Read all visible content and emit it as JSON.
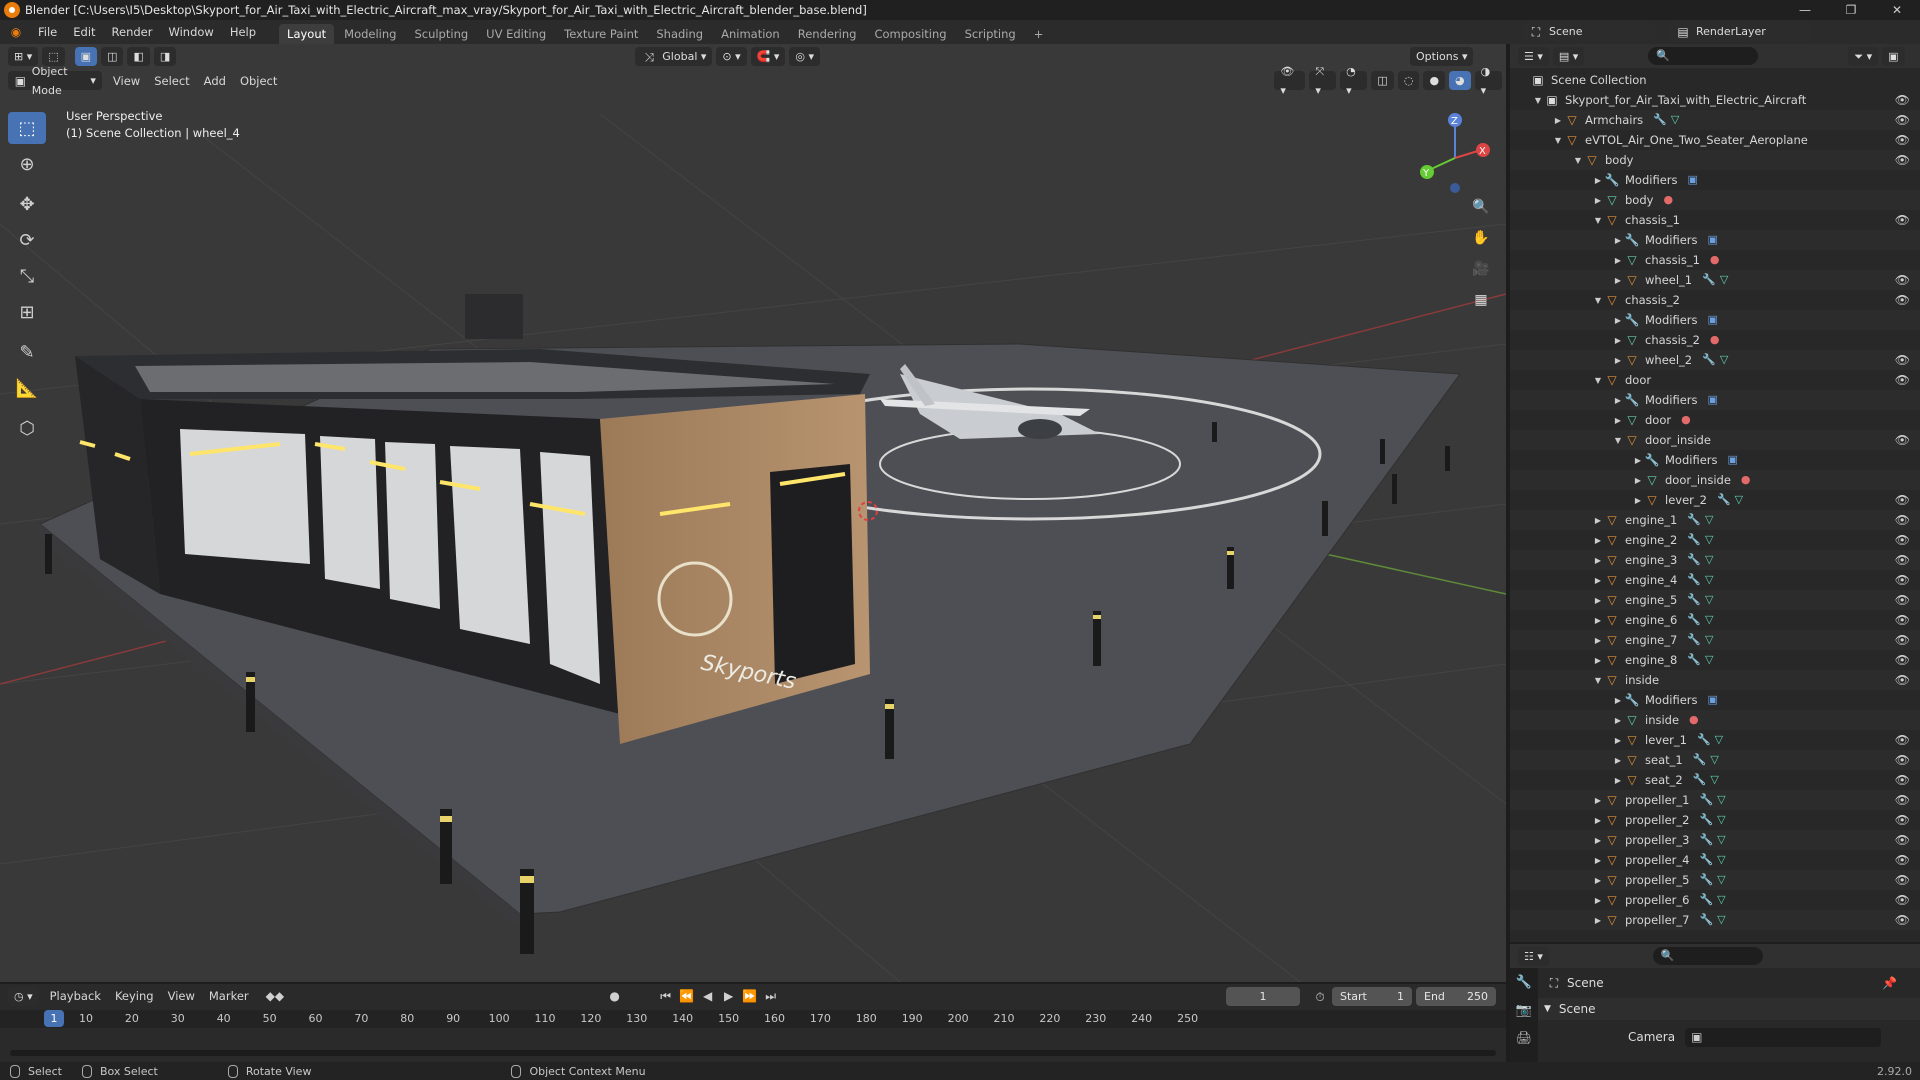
{
  "window": {
    "title": "Blender [C:\\Users\\I5\\Desktop\\Skyport_for_Air_Taxi_with_Electric_Aircraft_max_vray/Skyport_for_Air_Taxi_with_Electric_Aircraft_blender_base.blend]"
  },
  "menu": [
    "File",
    "Edit",
    "Render",
    "Window",
    "Help"
  ],
  "workspaces": [
    "Layout",
    "Modeling",
    "Sculpting",
    "UV Editing",
    "Texture Paint",
    "Shading",
    "Animation",
    "Rendering",
    "Compositing",
    "Scripting"
  ],
  "scene_selector": {
    "scene": "Scene",
    "render_layer": "RenderLayer"
  },
  "viewport": {
    "orientation": "Global",
    "options_label": "Options",
    "mode": "Object Mode",
    "menus": [
      "View",
      "Select",
      "Add",
      "Object"
    ],
    "info_line1": "User Perspective",
    "info_line2": "(1) Scene Collection | wheel_4",
    "building_sign": "Skyports",
    "gizmo": {
      "x": "X",
      "y": "Y",
      "z": "Z"
    }
  },
  "outliner": {
    "root": "Scene Collection",
    "rows": [
      {
        "label": "Skyport_for_Air_Taxi_with_Electric_Aircraft",
        "indent": 0,
        "type": "col",
        "expand": "▼",
        "eye": true,
        "badges": []
      },
      {
        "label": "Armchairs",
        "indent": 1,
        "type": "empty",
        "expand": "▶",
        "eye": true,
        "badges": [
          "w",
          "t"
        ]
      },
      {
        "label": "eVTOL_Air_One_Two_Seater_Aeroplane",
        "indent": 1,
        "type": "empty",
        "expand": "▼",
        "eye": true,
        "badges": []
      },
      {
        "label": "body",
        "indent": 2,
        "type": "empty",
        "expand": "▼",
        "eye": true,
        "badges": []
      },
      {
        "label": "Modifiers",
        "indent": 3,
        "type": "mod",
        "expand": "▶",
        "eye": false,
        "badges": [
          "mod"
        ]
      },
      {
        "label": "body",
        "indent": 3,
        "type": "mesh",
        "expand": "▶",
        "eye": false,
        "badges": [
          "m"
        ]
      },
      {
        "label": "chassis_1",
        "indent": 3,
        "type": "empty",
        "expand": "▼",
        "eye": true,
        "badges": []
      },
      {
        "label": "Modifiers",
        "indent": 4,
        "type": "mod",
        "expand": "▶",
        "eye": false,
        "badges": [
          "mod"
        ]
      },
      {
        "label": "chassis_1",
        "indent": 4,
        "type": "mesh",
        "expand": "▶",
        "eye": false,
        "badges": [
          "m"
        ]
      },
      {
        "label": "wheel_1",
        "indent": 4,
        "type": "empty",
        "expand": "▶",
        "eye": true,
        "badges": [
          "w",
          "t"
        ]
      },
      {
        "label": "chassis_2",
        "indent": 3,
        "type": "empty",
        "expand": "▼",
        "eye": true,
        "badges": []
      },
      {
        "label": "Modifiers",
        "indent": 4,
        "type": "mod",
        "expand": "▶",
        "eye": false,
        "badges": [
          "mod"
        ]
      },
      {
        "label": "chassis_2",
        "indent": 4,
        "type": "mesh",
        "expand": "▶",
        "eye": false,
        "badges": [
          "m"
        ]
      },
      {
        "label": "wheel_2",
        "indent": 4,
        "type": "empty",
        "expand": "▶",
        "eye": true,
        "badges": [
          "w",
          "t"
        ]
      },
      {
        "label": "door",
        "indent": 3,
        "type": "empty",
        "expand": "▼",
        "eye": true,
        "badges": []
      },
      {
        "label": "Modifiers",
        "indent": 4,
        "type": "mod",
        "expand": "▶",
        "eye": false,
        "badges": [
          "mod"
        ]
      },
      {
        "label": "door",
        "indent": 4,
        "type": "mesh",
        "expand": "▶",
        "eye": false,
        "badges": [
          "m"
        ]
      },
      {
        "label": "door_inside",
        "indent": 4,
        "type": "empty",
        "expand": "▼",
        "eye": true,
        "badges": []
      },
      {
        "label": "Modifiers",
        "indent": 5,
        "type": "mod",
        "expand": "▶",
        "eye": false,
        "badges": [
          "mod"
        ]
      },
      {
        "label": "door_inside",
        "indent": 5,
        "type": "mesh",
        "expand": "▶",
        "eye": false,
        "badges": [
          "m"
        ]
      },
      {
        "label": "lever_2",
        "indent": 5,
        "type": "empty",
        "expand": "▶",
        "eye": true,
        "badges": [
          "w",
          "t"
        ]
      },
      {
        "label": "engine_1",
        "indent": 3,
        "type": "empty",
        "expand": "▶",
        "eye": true,
        "badges": [
          "w",
          "t"
        ]
      },
      {
        "label": "engine_2",
        "indent": 3,
        "type": "empty",
        "expand": "▶",
        "eye": true,
        "badges": [
          "w",
          "t"
        ]
      },
      {
        "label": "engine_3",
        "indent": 3,
        "type": "empty",
        "expand": "▶",
        "eye": true,
        "badges": [
          "w",
          "t"
        ]
      },
      {
        "label": "engine_4",
        "indent": 3,
        "type": "empty",
        "expand": "▶",
        "eye": true,
        "badges": [
          "w",
          "t"
        ]
      },
      {
        "label": "engine_5",
        "indent": 3,
        "type": "empty",
        "expand": "▶",
        "eye": true,
        "badges": [
          "w",
          "t"
        ]
      },
      {
        "label": "engine_6",
        "indent": 3,
        "type": "empty",
        "expand": "▶",
        "eye": true,
        "badges": [
          "w",
          "t"
        ]
      },
      {
        "label": "engine_7",
        "indent": 3,
        "type": "empty",
        "expand": "▶",
        "eye": true,
        "badges": [
          "w",
          "t"
        ]
      },
      {
        "label": "engine_8",
        "indent": 3,
        "type": "empty",
        "expand": "▶",
        "eye": true,
        "badges": [
          "w",
          "t"
        ]
      },
      {
        "label": "inside",
        "indent": 3,
        "type": "empty",
        "expand": "▼",
        "eye": true,
        "badges": []
      },
      {
        "label": "Modifiers",
        "indent": 4,
        "type": "mod",
        "expand": "▶",
        "eye": false,
        "badges": [
          "mod"
        ]
      },
      {
        "label": "inside",
        "indent": 4,
        "type": "mesh",
        "expand": "▶",
        "eye": false,
        "badges": [
          "m"
        ]
      },
      {
        "label": "lever_1",
        "indent": 4,
        "type": "empty",
        "expand": "▶",
        "eye": true,
        "badges": [
          "w",
          "t"
        ]
      },
      {
        "label": "seat_1",
        "indent": 4,
        "type": "empty",
        "expand": "▶",
        "eye": true,
        "badges": [
          "w",
          "t"
        ]
      },
      {
        "label": "seat_2",
        "indent": 4,
        "type": "empty",
        "expand": "▶",
        "eye": true,
        "badges": [
          "w",
          "t"
        ]
      },
      {
        "label": "propeller_1",
        "indent": 3,
        "type": "empty",
        "expand": "▶",
        "eye": true,
        "badges": [
          "w",
          "t"
        ]
      },
      {
        "label": "propeller_2",
        "indent": 3,
        "type": "empty",
        "expand": "▶",
        "eye": true,
        "badges": [
          "w",
          "t"
        ]
      },
      {
        "label": "propeller_3",
        "indent": 3,
        "type": "empty",
        "expand": "▶",
        "eye": true,
        "badges": [
          "w",
          "t"
        ]
      },
      {
        "label": "propeller_4",
        "indent": 3,
        "type": "empty",
        "expand": "▶",
        "eye": true,
        "badges": [
          "w",
          "t"
        ]
      },
      {
        "label": "propeller_5",
        "indent": 3,
        "type": "empty",
        "expand": "▶",
        "eye": true,
        "badges": [
          "w",
          "t"
        ]
      },
      {
        "label": "propeller_6",
        "indent": 3,
        "type": "empty",
        "expand": "▶",
        "eye": true,
        "badges": [
          "w",
          "t"
        ]
      },
      {
        "label": "propeller_7",
        "indent": 3,
        "type": "empty",
        "expand": "▶",
        "eye": true,
        "badges": [
          "w",
          "t"
        ]
      }
    ]
  },
  "properties": {
    "context": "Scene",
    "panel": "Scene",
    "camera_label": "Camera"
  },
  "timeline": {
    "menus": [
      "Playback",
      "Keying",
      "View",
      "Marker"
    ],
    "current_frame": "1",
    "start_label": "Start",
    "start": "1",
    "end_label": "End",
    "end": "250",
    "ruler": [
      "10",
      "20",
      "30",
      "40",
      "50",
      "60",
      "70",
      "80",
      "90",
      "100",
      "110",
      "120",
      "130",
      "140",
      "150",
      "160",
      "170",
      "180",
      "190",
      "200",
      "210",
      "220",
      "230",
      "240",
      "250"
    ],
    "playhead": "1"
  },
  "status": {
    "select": "Select",
    "box_select": "Box Select",
    "rotate": "Rotate View",
    "context_menu": "Object Context Menu",
    "version": "2.92.0"
  },
  "colors": {
    "accent": "#4772b3",
    "empty_icon": "#e08f3a",
    "mesh_icon": "#5ecfb0"
  }
}
